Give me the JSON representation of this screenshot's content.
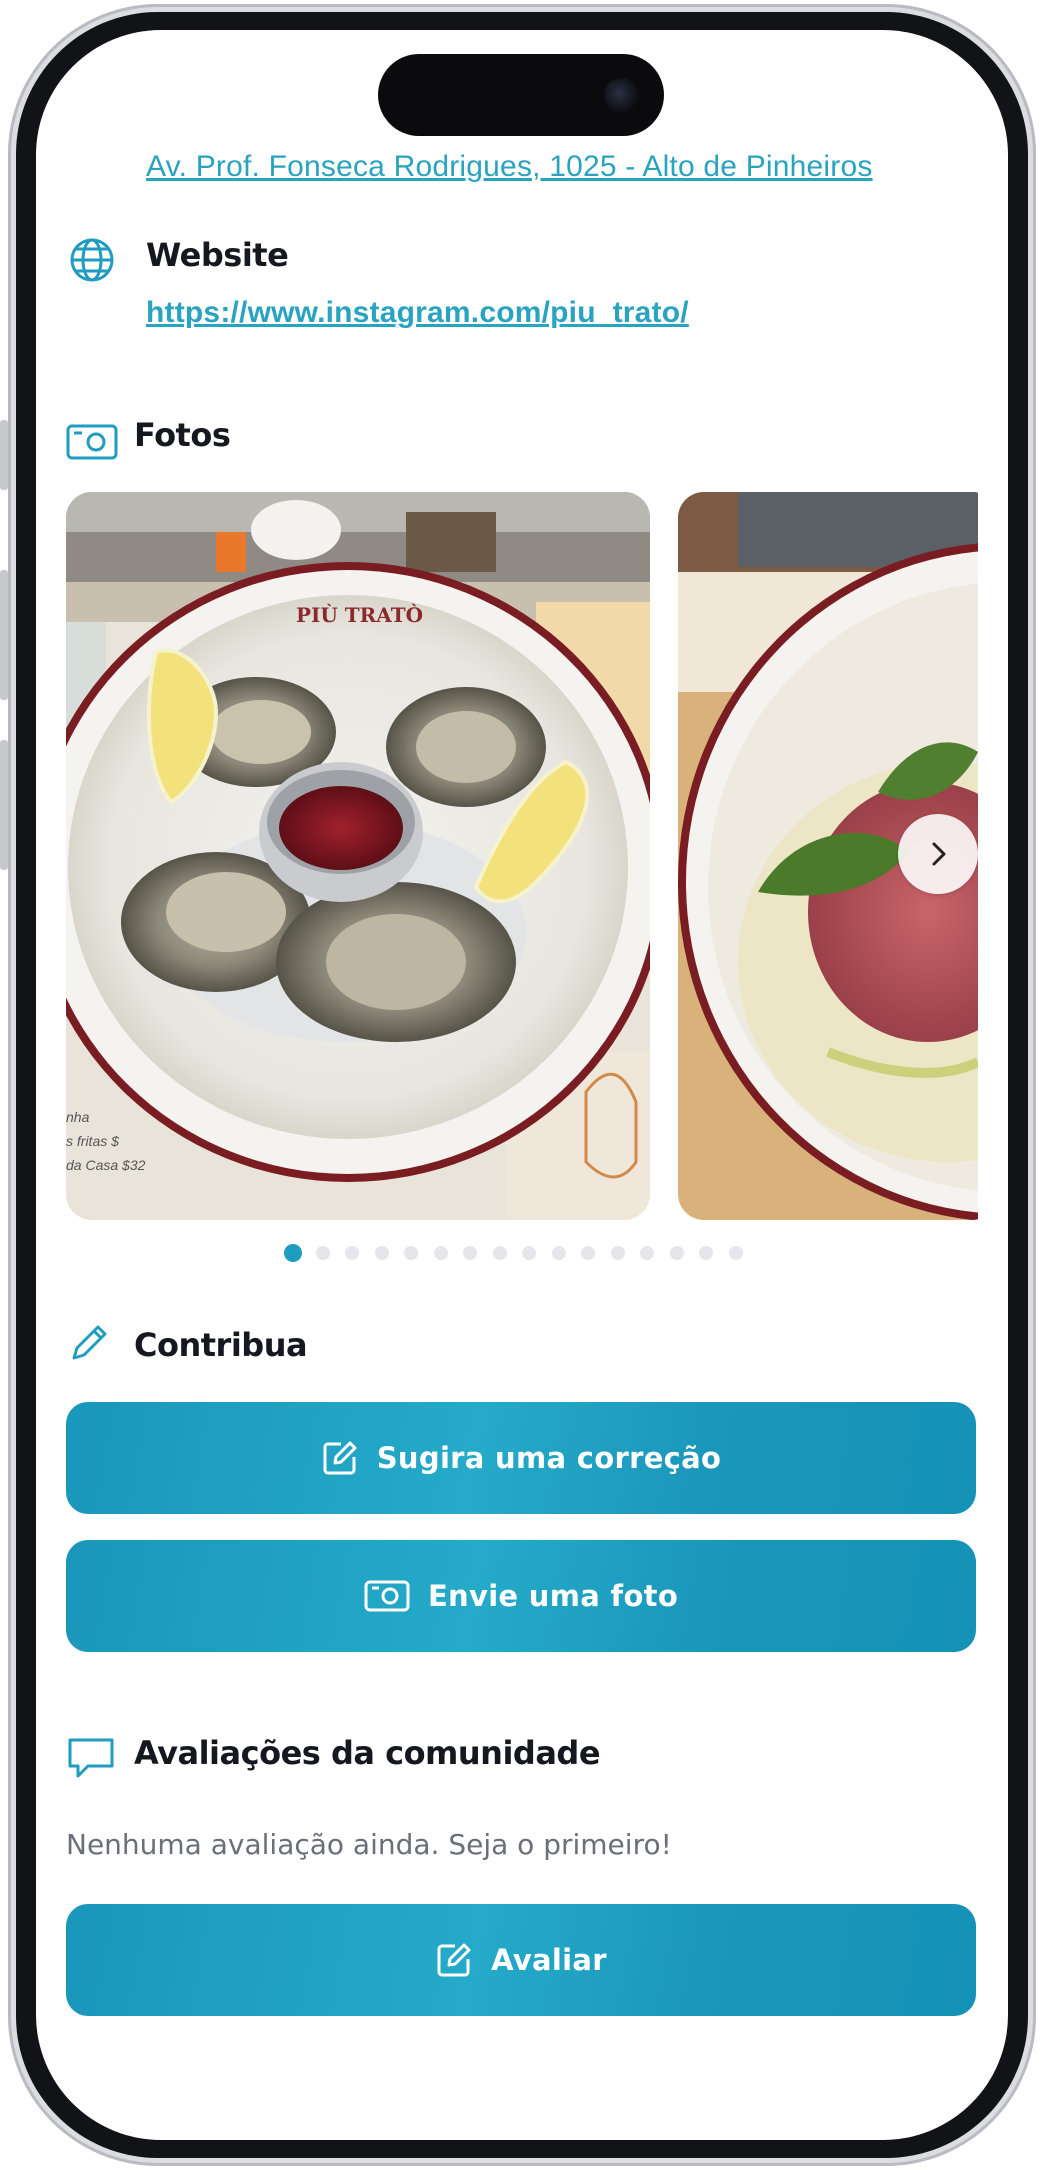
{
  "location": {
    "address": "Av. Prof. Fonseca Rodrigues, 1025 - Alto de Pinheiros"
  },
  "website": {
    "heading": "Website",
    "url": "https://www.instagram.com/piu_trato/"
  },
  "photos": {
    "heading": "Fotos",
    "photo_brand": "PIÙ TRATÒ",
    "menu_snippet": [
      "nha",
      "s fritas $",
      "da Casa $32"
    ],
    "page_count": 16,
    "active_page": 1
  },
  "contribute": {
    "heading": "Contribua",
    "suggest_label": "Sugira uma correção",
    "photo_label": "Envie uma foto"
  },
  "reviews": {
    "heading": "Avaliações da comunidade",
    "empty_text": "Nenhuma avaliação ainda. Seja o primeiro!",
    "rate_label": "Avaliar"
  },
  "colors": {
    "accent": "#1f9cc0",
    "link": "#2aa3c0",
    "heading": "#15181e",
    "muted": "#6a6f78"
  }
}
